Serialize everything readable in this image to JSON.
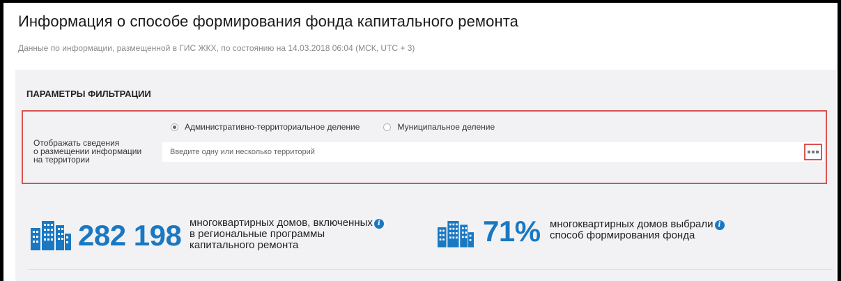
{
  "page": {
    "title": "Информация о способе формирования фонда капитального ремонта",
    "subtitle": "Данные по информации, размещенной в ГИС ЖКХ, по состоянию на 14.03.2018 06:04 (МСК, UTC + 3)"
  },
  "filters": {
    "heading": "ПАРАМЕТРЫ ФИЛЬТРАЦИИ",
    "label_lines": [
      "Отображать сведения",
      "о размещении информации",
      "на территории"
    ],
    "radio_options": [
      {
        "label": "Административно-территориальное деление",
        "selected": true
      },
      {
        "label": "Муниципальное деление",
        "selected": false
      }
    ],
    "territory_placeholder": "Введите одну или несколько территорий",
    "more_button_icon": "ellipsis-icon"
  },
  "stats": [
    {
      "value": "282 198",
      "text_lines": [
        "многоквартирных домов, включенных",
        "в региональные программы",
        "капитального ремонта"
      ],
      "icon": "buildings-icon",
      "info_icon": "info-icon"
    },
    {
      "value": "71%",
      "text_lines": [
        "многоквартирных домов выбрали",
        "способ формирования фонда"
      ],
      "icon": "buildings-icon",
      "info_icon": "info-icon"
    }
  ],
  "colors": {
    "accent_blue": "#1a78c2",
    "highlight_red": "#d9534f",
    "panel_bg": "#f2f2f4"
  }
}
